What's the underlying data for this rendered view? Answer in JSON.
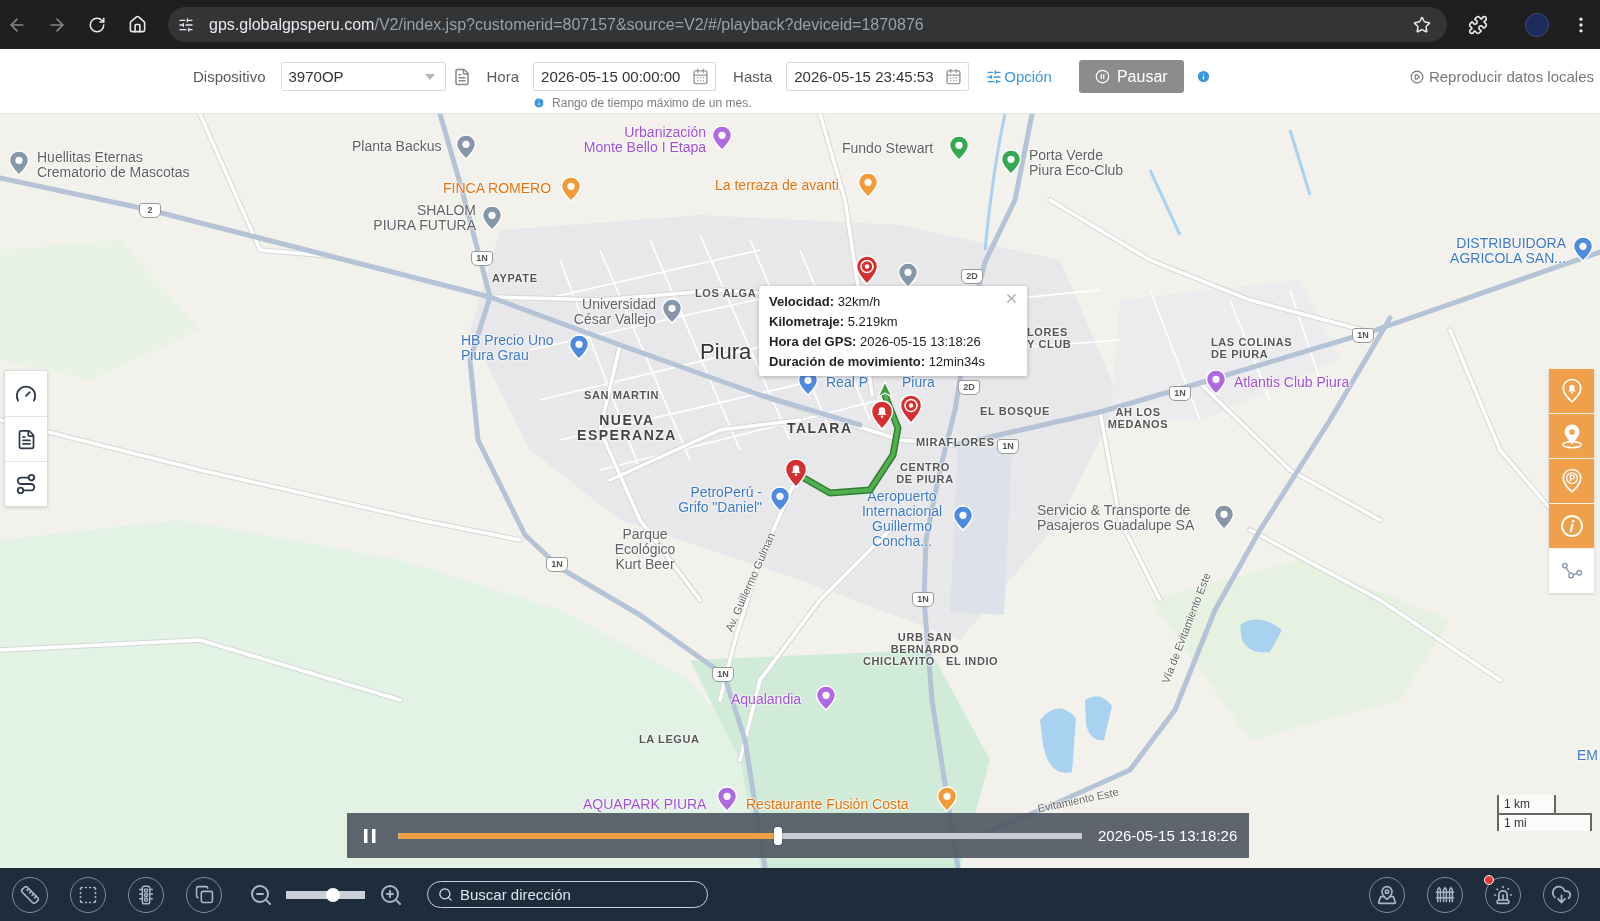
{
  "browser": {
    "back_enabled": false,
    "forward_enabled": false,
    "url_host": "gps.globalgpsperu.com",
    "url_path": "/V2/index.jsp?customerid=807157&source=V2/#/playback?deviceid=1870876"
  },
  "toolbar": {
    "device_label": "Dispositivo",
    "device": "3970OP",
    "from_label": "Hora",
    "from": "2026-05-15 00:00:00",
    "hint": "Rango de tiempo máximo de un mes.",
    "to_label": "Hasta",
    "to": "2026-05-15 23:45:53",
    "option": "Opción",
    "pause": "Pausar",
    "local_playback": "Reproducir datos locales"
  },
  "map": {
    "labels": [
      {
        "lines": [
          "Huellitas Eternas",
          "Crematorio de Mascotas"
        ],
        "kind": "landmark"
      },
      {
        "lines": [
          "Planta Backus"
        ],
        "kind": "landmark"
      },
      {
        "lines": [
          "Urbanización",
          "Monte Bello I Etapa"
        ],
        "kind": "attraction"
      },
      {
        "lines": [
          "Fundo Stewart"
        ],
        "kind": "park"
      },
      {
        "lines": [
          "Porta Verde",
          "Piura Eco-Club"
        ],
        "kind": "park"
      },
      {
        "lines": [
          "FINCA ROMERO"
        ],
        "kind": "restaurant"
      },
      {
        "lines": [
          "La terraza de avanti"
        ],
        "kind": "restaurant"
      },
      {
        "lines": [
          "SHALOM",
          "PIURA FUTURA"
        ],
        "kind": "landmark"
      },
      {
        "lines": [
          "AYPATE"
        ],
        "kind": "district"
      },
      {
        "lines": [
          "LOS ALGA"
        ],
        "kind": "district"
      },
      {
        "lines": [
          "Universidad",
          "César Vallejo"
        ],
        "kind": "landmark"
      },
      {
        "lines": [
          "HB Precio Uno",
          "Piura Grau"
        ],
        "kind": "store"
      },
      {
        "lines": [
          "Piura"
        ],
        "kind": "city"
      },
      {
        "lines": [
          "SAN MARTIN"
        ],
        "kind": "district"
      },
      {
        "lines": [
          "NUEVA",
          "ESPERANZA"
        ],
        "kind": "suburb"
      },
      {
        "lines": [
          "TALARA"
        ],
        "kind": "suburb"
      },
      {
        "lines": [
          "Real P"
        ],
        "kind": "store"
      },
      {
        "lines": [
          "Piura"
        ],
        "kind": "store"
      },
      {
        "lines": [
          "LORES",
          "Y CLUB"
        ],
        "kind": "district"
      },
      {
        "lines": [
          "EL BOSQUE"
        ],
        "kind": "district"
      },
      {
        "lines": [
          "MIRAFLORES"
        ],
        "kind": "district"
      },
      {
        "lines": [
          "CENTRO",
          "DE PIURA"
        ],
        "kind": "district"
      },
      {
        "lines": [
          "LAS COLINAS",
          "DE PIURA"
        ],
        "kind": "district"
      },
      {
        "lines": [
          "Atlantis Club Piura"
        ],
        "kind": "attraction"
      },
      {
        "lines": [
          "AH LOS",
          "MEDANOS"
        ],
        "kind": "district"
      },
      {
        "lines": [
          "DISTRIBUIDORA",
          "AGRICOLA SAN..."
        ],
        "kind": "store"
      },
      {
        "lines": [
          "PetroPerú -",
          "Grifo \"Daniel\""
        ],
        "kind": "store"
      },
      {
        "lines": [
          "Aeropuerto",
          "Internacional",
          "Guillermo",
          "Concha..."
        ],
        "kind": "store"
      },
      {
        "lines": [
          "Servicio & Transporte de",
          "Pasajeros Guadalupe SA"
        ],
        "kind": "landmark"
      },
      {
        "lines": [
          "Parque",
          "Ecológico",
          "Kurt Beer"
        ],
        "kind": "landmark"
      },
      {
        "lines": [
          "Av. Guillermo Gulman"
        ],
        "kind": "road"
      },
      {
        "lines": [
          "URB SAN",
          "BERNARDO"
        ],
        "kind": "district"
      },
      {
        "lines": [
          "CHICLAYITO"
        ],
        "kind": "district"
      },
      {
        "lines": [
          "EL INDIO"
        ],
        "kind": "district"
      },
      {
        "lines": [
          "Vía de Evitamiento Este"
        ],
        "kind": "road"
      },
      {
        "lines": [
          "Aqualandia"
        ],
        "kind": "attraction"
      },
      {
        "lines": [
          "LA LEGUA"
        ],
        "kind": "district"
      },
      {
        "lines": [
          "AQUAPARK PIURA"
        ],
        "kind": "attraction"
      },
      {
        "lines": [
          "Restaurante Fusión Costa"
        ],
        "kind": "restaurant"
      },
      {
        "lines": [
          "Evitamiento Este"
        ],
        "kind": "road"
      },
      {
        "lines": [
          "EM"
        ],
        "kind": "store"
      }
    ],
    "road_shields": [
      "2",
      "1N",
      "2D",
      "1N",
      "1N",
      "2D",
      "1N",
      "1N",
      "1N",
      "1N"
    ]
  },
  "layer_toggles": [
    {
      "on": true
    },
    {
      "on": true
    },
    {
      "on": true
    },
    {
      "on": true
    },
    {
      "on": false
    }
  ],
  "info_popup": {
    "rows": [
      "**Velocidad:** 32km/h",
      "**Kilometraje:** 5.219km",
      "**Hora del GPS:** 2026-05-15 13:18:26",
      "**Duración de movimiento:** 12min34s"
    ]
  },
  "playback": {
    "playing": true,
    "level": 0.555,
    "time": "2026-05-15 13:18:26"
  },
  "scale": {
    "metric": "1 km",
    "imperial": "1 mi"
  },
  "bottom_bar": {
    "zoom": {
      "level": 0.6
    },
    "search": {
      "placeholder": "Buscar dirección"
    },
    "right_tools": [
      {
        "badge": false
      },
      {
        "badge": false
      },
      {
        "badge": true
      },
      {
        "badge": false
      }
    ]
  }
}
